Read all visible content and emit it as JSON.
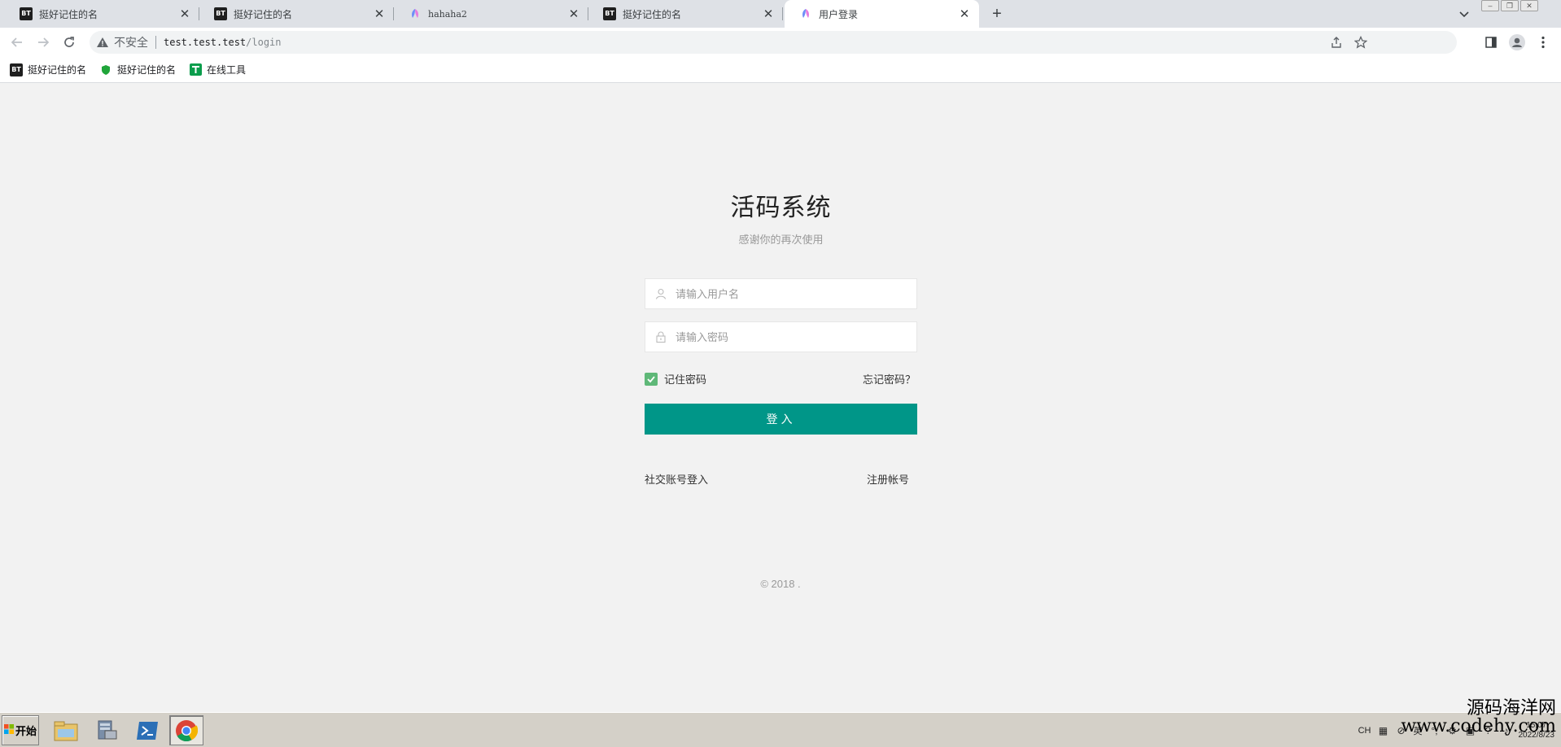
{
  "browser": {
    "tabs": [
      {
        "title": "挺好记住的名",
        "icon": "bt-panel-icon",
        "active": false
      },
      {
        "title": "挺好记住的名",
        "icon": "bt-panel-icon",
        "active": false
      },
      {
        "title": "hahaha2",
        "icon": "app-logo-icon",
        "active": false
      },
      {
        "title": "挺好记住的名",
        "icon": "bt-panel-icon",
        "active": false
      },
      {
        "title": "用户登录",
        "icon": "app-logo-icon",
        "active": true
      }
    ],
    "new_tab_label": "+",
    "close_label": "✕",
    "address": {
      "insecure_label": "不安全",
      "host": "test.test.test",
      "path": "/login"
    },
    "bookmarks": [
      {
        "label": "挺好记住的名",
        "icon": "bt-panel-icon"
      },
      {
        "label": "挺好记住的名",
        "icon": "shield-icon"
      },
      {
        "label": "在线工具",
        "icon": "tools-icon"
      }
    ],
    "bt_icon_text": "BT"
  },
  "login": {
    "title": "活码系统",
    "subtitle": "感谢你的再次使用",
    "username_placeholder": "请输入用户名",
    "password_placeholder": "请输入密码",
    "remember_label": "记住密码",
    "remember_checked": true,
    "forgot_label": "忘记密码？",
    "submit_label": "登入",
    "social_label": "社交账号登入",
    "register_label": "注册帐号",
    "copyright": "© 2018  ."
  },
  "taskbar": {
    "start_label": "开始",
    "apps": [
      "file-explorer-icon",
      "server-manager-icon",
      "powershell-icon",
      "chrome-icon"
    ],
    "tray": {
      "lang": "CH",
      "ime": "英",
      "time": "15:07",
      "date": "2022/8/23"
    }
  },
  "watermark": {
    "line1": "源码海洋网",
    "line2": "www.codehy.com"
  },
  "colors": {
    "primary": "#009688",
    "checkbox": "#5fb878",
    "page_bg": "#f2f2f2"
  }
}
